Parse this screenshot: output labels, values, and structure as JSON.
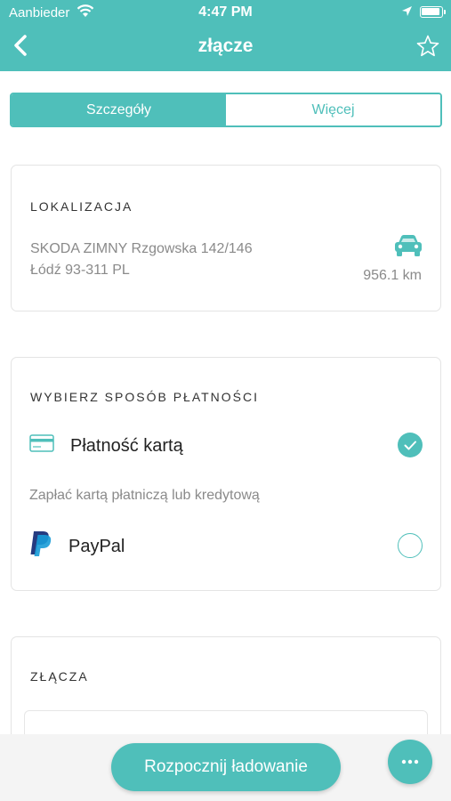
{
  "status_bar": {
    "carrier": "Aanbieder",
    "time": "4:47 PM"
  },
  "navbar": {
    "title": "złącze"
  },
  "tabs": [
    {
      "label": "Szczegóły",
      "active": true
    },
    {
      "label": "Więcej",
      "active": false
    }
  ],
  "location": {
    "title": "LOKALIZACJA",
    "address_line1": "SKODA ZIMNY Rzgowska 142/146",
    "address_line2": "Łódź 93-311 PL",
    "distance": "956.1 km"
  },
  "payment": {
    "title": "WYBIERZ SPOSÓB PŁATNOŚCI",
    "card_label": "Płatność kartą",
    "card_selected": true,
    "card_description": "Zapłać kartą płatniczą lub kredytową",
    "paypal_label": "PayPal",
    "paypal_selected": false
  },
  "connectors": {
    "title": "ZŁĄCZA"
  },
  "actions": {
    "start_label": "Rozpocznij ładowanie"
  },
  "colors": {
    "accent": "#4fbfba",
    "paypal_dark": "#253b80",
    "paypal_light": "#179bd7"
  }
}
